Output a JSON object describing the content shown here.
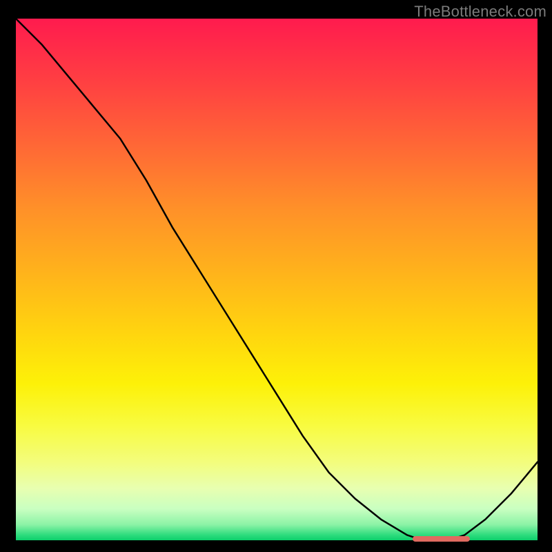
{
  "watermark": "TheBottleneck.com",
  "chart_data": {
    "type": "line",
    "title": "",
    "xlabel": "",
    "ylabel": "",
    "x_range": [
      0,
      100
    ],
    "y_range": [
      0,
      100
    ],
    "grid": false,
    "background": "rainbow-vertical-gradient",
    "series": [
      {
        "name": "bottleneck-curve",
        "x": [
          0,
          5,
          10,
          15,
          20,
          25,
          30,
          35,
          40,
          45,
          50,
          55,
          60,
          65,
          70,
          75,
          78,
          80,
          83,
          86,
          90,
          95,
          100
        ],
        "y": [
          100,
          95,
          89,
          83,
          77,
          69,
          60,
          52,
          44,
          36,
          28,
          20,
          13,
          8,
          4,
          1,
          0,
          0,
          0,
          1,
          4,
          9,
          15
        ]
      }
    ],
    "annotations": [
      {
        "name": "optimal-range-marker",
        "x_start": 76,
        "x_end": 87,
        "y": 0
      }
    ]
  },
  "colors": {
    "curve": "#000000",
    "marker": "#e06a60",
    "watermark": "#7b7b7b"
  }
}
